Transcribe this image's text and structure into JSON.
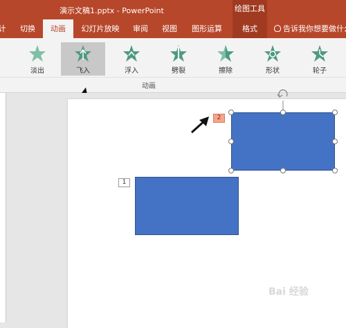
{
  "window": {
    "title": "演示文稿1.pptx - PowerPoint",
    "context_tools_label": "绘图工具"
  },
  "tabs": [
    {
      "label": "计",
      "active": false
    },
    {
      "label": "切换",
      "active": false
    },
    {
      "label": "动画",
      "active": true
    },
    {
      "label": "幻灯片放映",
      "active": false
    },
    {
      "label": "审阅",
      "active": false
    },
    {
      "label": "视图",
      "active": false
    },
    {
      "label": "图形运算",
      "active": false
    },
    {
      "label": "格式",
      "active": false
    }
  ],
  "tell_me": {
    "text": "告诉我你想要做什么",
    "icon": "lightbulb-icon"
  },
  "animations": {
    "group_label": "动画",
    "items": [
      {
        "label": "淡出",
        "icon": "fade-star-icon",
        "selected": false
      },
      {
        "label": "飞入",
        "icon": "fly-in-star-icon",
        "selected": true
      },
      {
        "label": "浮入",
        "icon": "float-in-star-icon",
        "selected": false
      },
      {
        "label": "劈裂",
        "icon": "split-star-icon",
        "selected": false
      },
      {
        "label": "擦除",
        "icon": "wipe-star-icon",
        "selected": false
      },
      {
        "label": "形状",
        "icon": "shape-star-icon",
        "selected": false
      },
      {
        "label": "轮子",
        "icon": "wheel-star-icon",
        "selected": false
      }
    ]
  },
  "slide": {
    "animation_tags": [
      "1",
      "2"
    ],
    "shape_color": "#4472c4"
  },
  "colors": {
    "accent": "#b7472a",
    "star": "#4e9a7e"
  },
  "watermark": "Bai 经验"
}
